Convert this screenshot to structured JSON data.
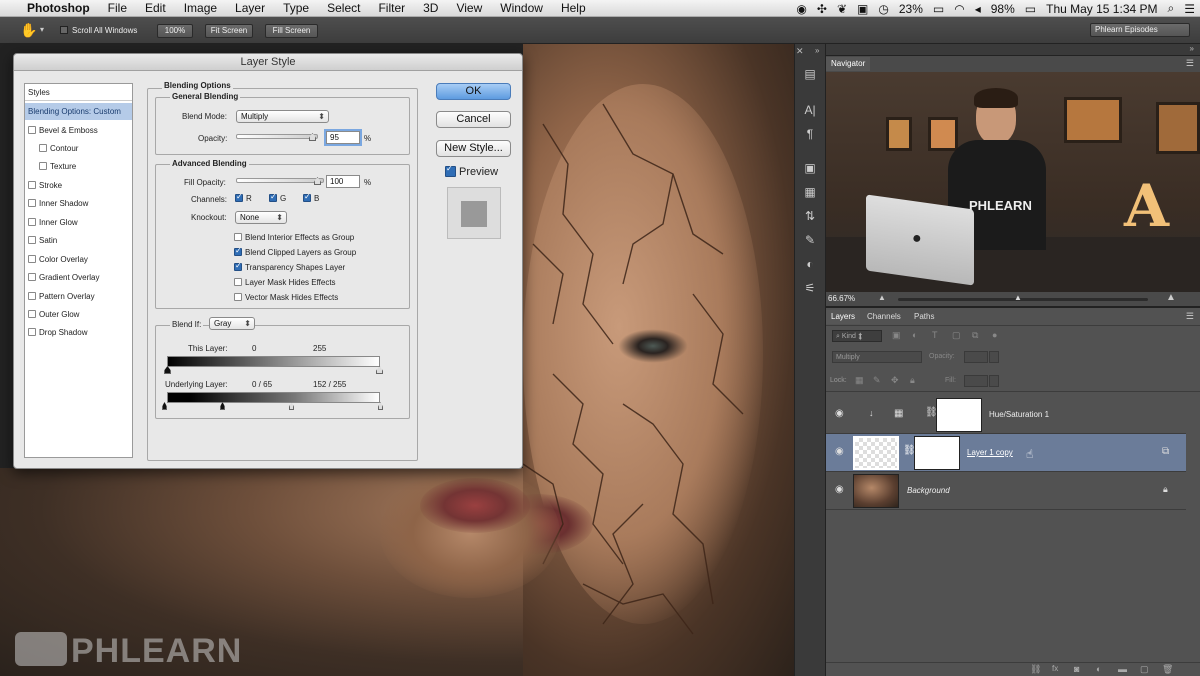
{
  "menubar": {
    "apple": "",
    "app": "Photoshop",
    "items": [
      "File",
      "Edit",
      "Image",
      "Layer",
      "Type",
      "Select",
      "Filter",
      "3D",
      "View",
      "Window",
      "Help"
    ],
    "battery_pct": "23%",
    "wifi_pct": "98%",
    "datetime": "Thu May 15  1:34 PM"
  },
  "options_bar": {
    "scroll_all_windows": "Scroll All Windows",
    "zoom_btn": "100%",
    "fit_screen": "Fit Screen",
    "fill_screen": "Fill Screen",
    "workspace": "Phlearn Episodes"
  },
  "dialog": {
    "title": "Layer Style",
    "styles_header": "Styles",
    "styles": [
      {
        "label": "Blending Options: Custom",
        "checkbox": false,
        "selected": true
      },
      {
        "label": "Bevel & Emboss",
        "checkbox": true
      },
      {
        "label": "Contour",
        "checkbox": true,
        "indent": true
      },
      {
        "label": "Texture",
        "checkbox": true,
        "indent": true
      },
      {
        "label": "Stroke",
        "checkbox": true
      },
      {
        "label": "Inner Shadow",
        "checkbox": true
      },
      {
        "label": "Inner Glow",
        "checkbox": true
      },
      {
        "label": "Satin",
        "checkbox": true
      },
      {
        "label": "Color Overlay",
        "checkbox": true
      },
      {
        "label": "Gradient Overlay",
        "checkbox": true
      },
      {
        "label": "Pattern Overlay",
        "checkbox": true
      },
      {
        "label": "Outer Glow",
        "checkbox": true
      },
      {
        "label": "Drop Shadow",
        "checkbox": true
      }
    ],
    "blending_options": "Blending Options",
    "general_blending": "General Blending",
    "blend_mode_label": "Blend Mode:",
    "blend_mode": "Multiply",
    "opacity_label": "Opacity:",
    "opacity_value": "95",
    "pct": "%",
    "advanced_blending": "Advanced Blending",
    "fill_opacity_label": "Fill Opacity:",
    "fill_opacity_value": "100",
    "channels_label": "Channels:",
    "channel_r": "R",
    "channel_g": "G",
    "channel_b": "B",
    "knockout_label": "Knockout:",
    "knockout_value": "None",
    "opt_blend_interior": "Blend Interior Effects as Group",
    "opt_blend_clipped": "Blend Clipped Layers as Group",
    "opt_transparency": "Transparency Shapes Layer",
    "opt_layer_mask": "Layer Mask Hides Effects",
    "opt_vector_mask": "Vector Mask Hides Effects",
    "blend_if_label": "Blend If:",
    "blend_if_value": "Gray",
    "this_layer_label": "This Layer:",
    "this_layer_low": "0",
    "this_layer_high": "255",
    "underlying_label": "Underlying Layer:",
    "underlying_values": "0  /  65",
    "underlying_values2": "152  /  255",
    "ok": "OK",
    "cancel": "Cancel",
    "new_style": "New Style...",
    "preview": "Preview"
  },
  "navigator": {
    "tab": "Navigator",
    "zoom": "66.67%",
    "shirt_text": "PHLEARN"
  },
  "layers": {
    "tabs": [
      "Layers",
      "Channels",
      "Paths"
    ],
    "kind": "Kind",
    "blend_mode": "Multiply",
    "opacity_label": "Opacity:",
    "lock_label": "Lock:",
    "fill_label": "Fill:",
    "rows": [
      {
        "name": "Hue/Saturation 1"
      },
      {
        "name": "Layer 1 copy"
      },
      {
        "name": "Background"
      }
    ]
  },
  "watermark": "PHLEARN"
}
